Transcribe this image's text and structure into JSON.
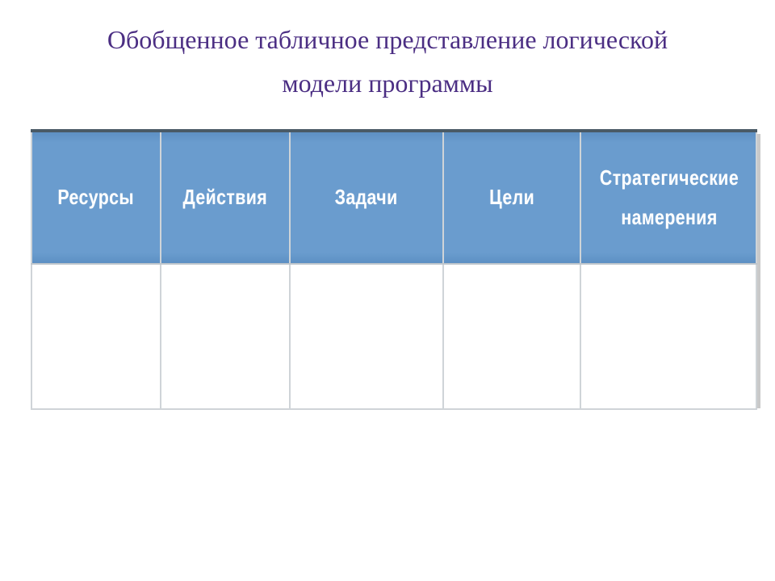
{
  "title_line1": "Обобщенное табличное представление логической",
  "title_line2": "модели программы",
  "table": {
    "headers": [
      "Ресурсы",
      "Действия",
      "Задачи",
      "Цели",
      "Стратегические намерения"
    ],
    "rows": [
      [
        "",
        "",
        "",
        "",
        ""
      ]
    ]
  },
  "colors": {
    "title": "#4b2e83",
    "header_bg": "#6699cc",
    "header_text": "#ffffff"
  }
}
